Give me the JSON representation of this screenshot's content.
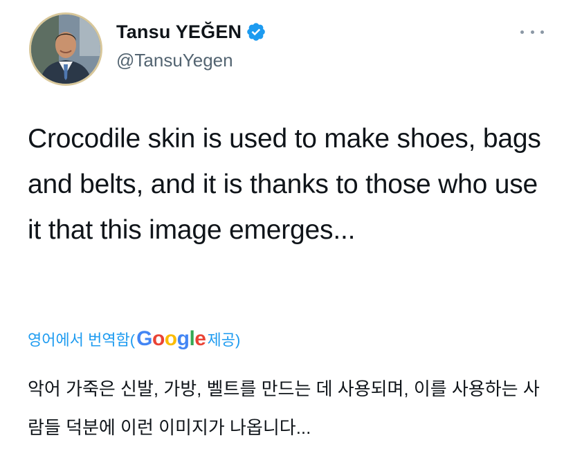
{
  "author": {
    "display_name": "Tansu YEĞEN",
    "handle": "@TansuYegen",
    "verified": true,
    "avatar_icon": "profile-photo"
  },
  "more_icon": "ellipsis-horizontal-icon",
  "tweet": {
    "text": "Crocodile skin is used to make shoes, bags and belts, and it is thanks to those who use it that this image emerges..."
  },
  "translation": {
    "prefix": "영어에서 번역함(",
    "provider_letters": [
      "G",
      "o",
      "o",
      "g",
      "l",
      "e"
    ],
    "suffix": " 제공)",
    "text": "악어 가죽은 신발, 가방, 벨트를 만드는 데 사용되며, 이를 사용하는 사람들 덕분에 이런 이미지가 나옵니다..."
  },
  "colors": {
    "accent": "#1d9bf0",
    "text_primary": "#0f1419",
    "text_secondary": "#536471",
    "verified_badge": "#1d9bf0",
    "google_blue": "#4285f4",
    "google_red": "#ea4335",
    "google_yellow": "#fbbc05",
    "google_green": "#34a853"
  }
}
